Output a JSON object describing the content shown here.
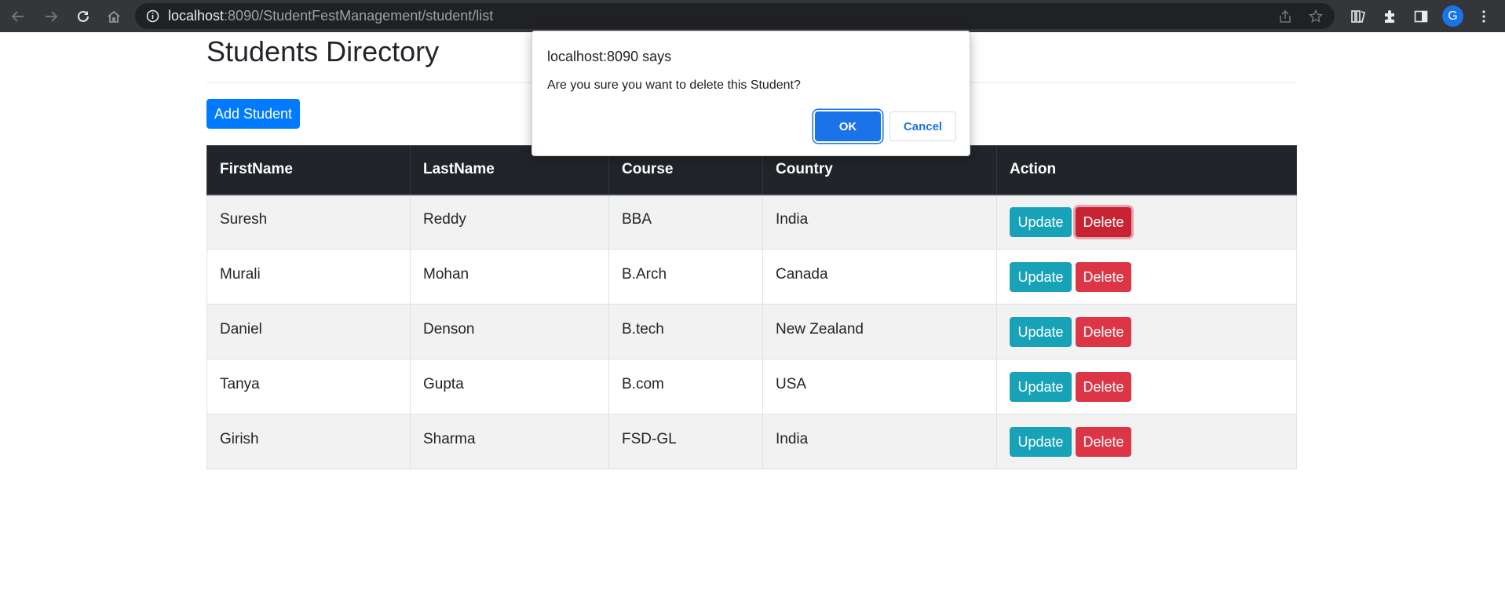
{
  "browser": {
    "url_host": "localhost",
    "url_path": ":8090/StudentFestManagement/student/list",
    "avatar_letter": "G",
    "icons": [
      "back-icon",
      "forward-icon",
      "reload-icon",
      "home-icon",
      "site-info-icon",
      "share-icon",
      "bookmark-star-icon",
      "reading-list-icon",
      "extensions-icon",
      "side-panel-icon",
      "profile-avatar",
      "menu-icon"
    ]
  },
  "page": {
    "title": "Students Directory",
    "add_button": "Add Student"
  },
  "table": {
    "headers": [
      "FirstName",
      "LastName",
      "Course",
      "Country",
      "Action"
    ],
    "rows": [
      [
        "Suresh",
        "Reddy",
        "BBA",
        "India"
      ],
      [
        "Murali",
        "Mohan",
        "B.Arch",
        "Canada"
      ],
      [
        "Daniel",
        "Denson",
        "B.tech",
        "New Zealand"
      ],
      [
        "Tanya",
        "Gupta",
        "B.com",
        "USA"
      ],
      [
        "Girish",
        "Sharma",
        "FSD-GL",
        "India"
      ]
    ],
    "update_label": "Update",
    "delete_label": "Delete"
  },
  "dialog": {
    "title": "localhost:8090 says",
    "message": "Are you sure you want to delete this Student?",
    "ok_label": "OK",
    "cancel_label": "Cancel"
  },
  "colors": {
    "primary": "#007bff",
    "info": "#17a2b8",
    "danger": "#dc3545",
    "table_header": "#212529",
    "dialog_accent": "#1a73e8"
  }
}
